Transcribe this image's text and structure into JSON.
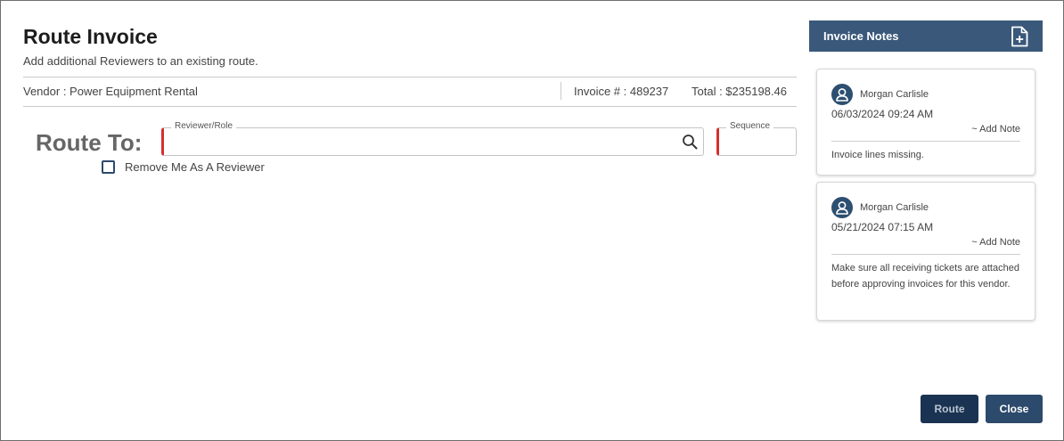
{
  "dialog": {
    "title": "Route Invoice",
    "subtitle": "Add additional Reviewers to an existing route."
  },
  "invoice": {
    "vendor": "Vendor : Power Equipment Rental",
    "number": "Invoice # : 489237",
    "total": "Total : $235198.46"
  },
  "form": {
    "route_to_label": "Route To:",
    "reviewer_label": "Reviewer/Role",
    "reviewer_value": "",
    "sequence_label": "Sequence",
    "sequence_value": "",
    "remove_me_label": "Remove Me As A Reviewer",
    "remove_me_checked": false,
    "required_color": "#d32f2f"
  },
  "notes_panel": {
    "title": "Invoice Notes",
    "add_icon": "file-plus-icon",
    "header_color": "#3a587a",
    "notes": [
      {
        "author": "Morgan Carlisle",
        "timestamp": "06/03/2024 09:24 AM",
        "add_note_label": "~ Add Note",
        "text": "Invoice lines missing."
      },
      {
        "author": "Morgan Carlisle",
        "timestamp": "05/21/2024 07:15 AM",
        "add_note_label": "~ Add Note",
        "text": "Make sure all receiving tickets are attached before approving invoices for this vendor."
      }
    ]
  },
  "actions": {
    "route_label": "Route",
    "close_label": "Close"
  }
}
